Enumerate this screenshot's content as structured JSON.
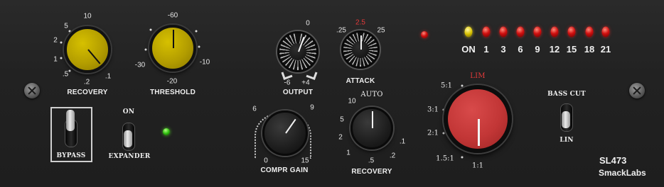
{
  "recovery_left": {
    "label": "RECOVERY",
    "scale": [
      "10",
      "5",
      "2",
      "1",
      ".5",
      ".2",
      ".1"
    ]
  },
  "threshold": {
    "label": "THRESHOLD",
    "scale": [
      "-60",
      "-30",
      "-20",
      "-10"
    ]
  },
  "output": {
    "label": "OUTPUT",
    "scale": [
      "0",
      "-6",
      "+4"
    ]
  },
  "attack": {
    "label": "ATTACK",
    "scale_left": ".25",
    "scale_center": "2.5",
    "scale_right": "25"
  },
  "compr_gain": {
    "label": "COMPR GAIN",
    "scale": [
      "6",
      "9",
      "0",
      "15"
    ]
  },
  "recovery_center": {
    "label": "RECOVERY",
    "top": "AUTO",
    "scale": [
      "10",
      "5",
      "2",
      "1",
      ".5",
      ".2",
      ".1"
    ]
  },
  "ratio": {
    "top": "LIM",
    "scale": [
      "5:1",
      "3:1",
      "2:1",
      "1.5:1",
      "1:1"
    ]
  },
  "bypass": {
    "label": "BYPASS"
  },
  "expander": {
    "label_top": "ON",
    "label": "EXPANDER"
  },
  "bass_cut": {
    "label_top": "BASS CUT",
    "label_bottom": "LIN"
  },
  "meter": {
    "labels": [
      "ON",
      "1",
      "3",
      "6",
      "9",
      "12",
      "15",
      "18",
      "21"
    ]
  },
  "brand": {
    "model": "SL473",
    "maker": "SmackLabs"
  },
  "colors": {
    "gold": "#c2aa00",
    "red_knob": "#c53838",
    "led_red": "#d01010",
    "led_yellow": "#d8c200",
    "accent_red_text": "#e23a3a"
  },
  "icons": [
    "screw-icon",
    "led-icon"
  ]
}
